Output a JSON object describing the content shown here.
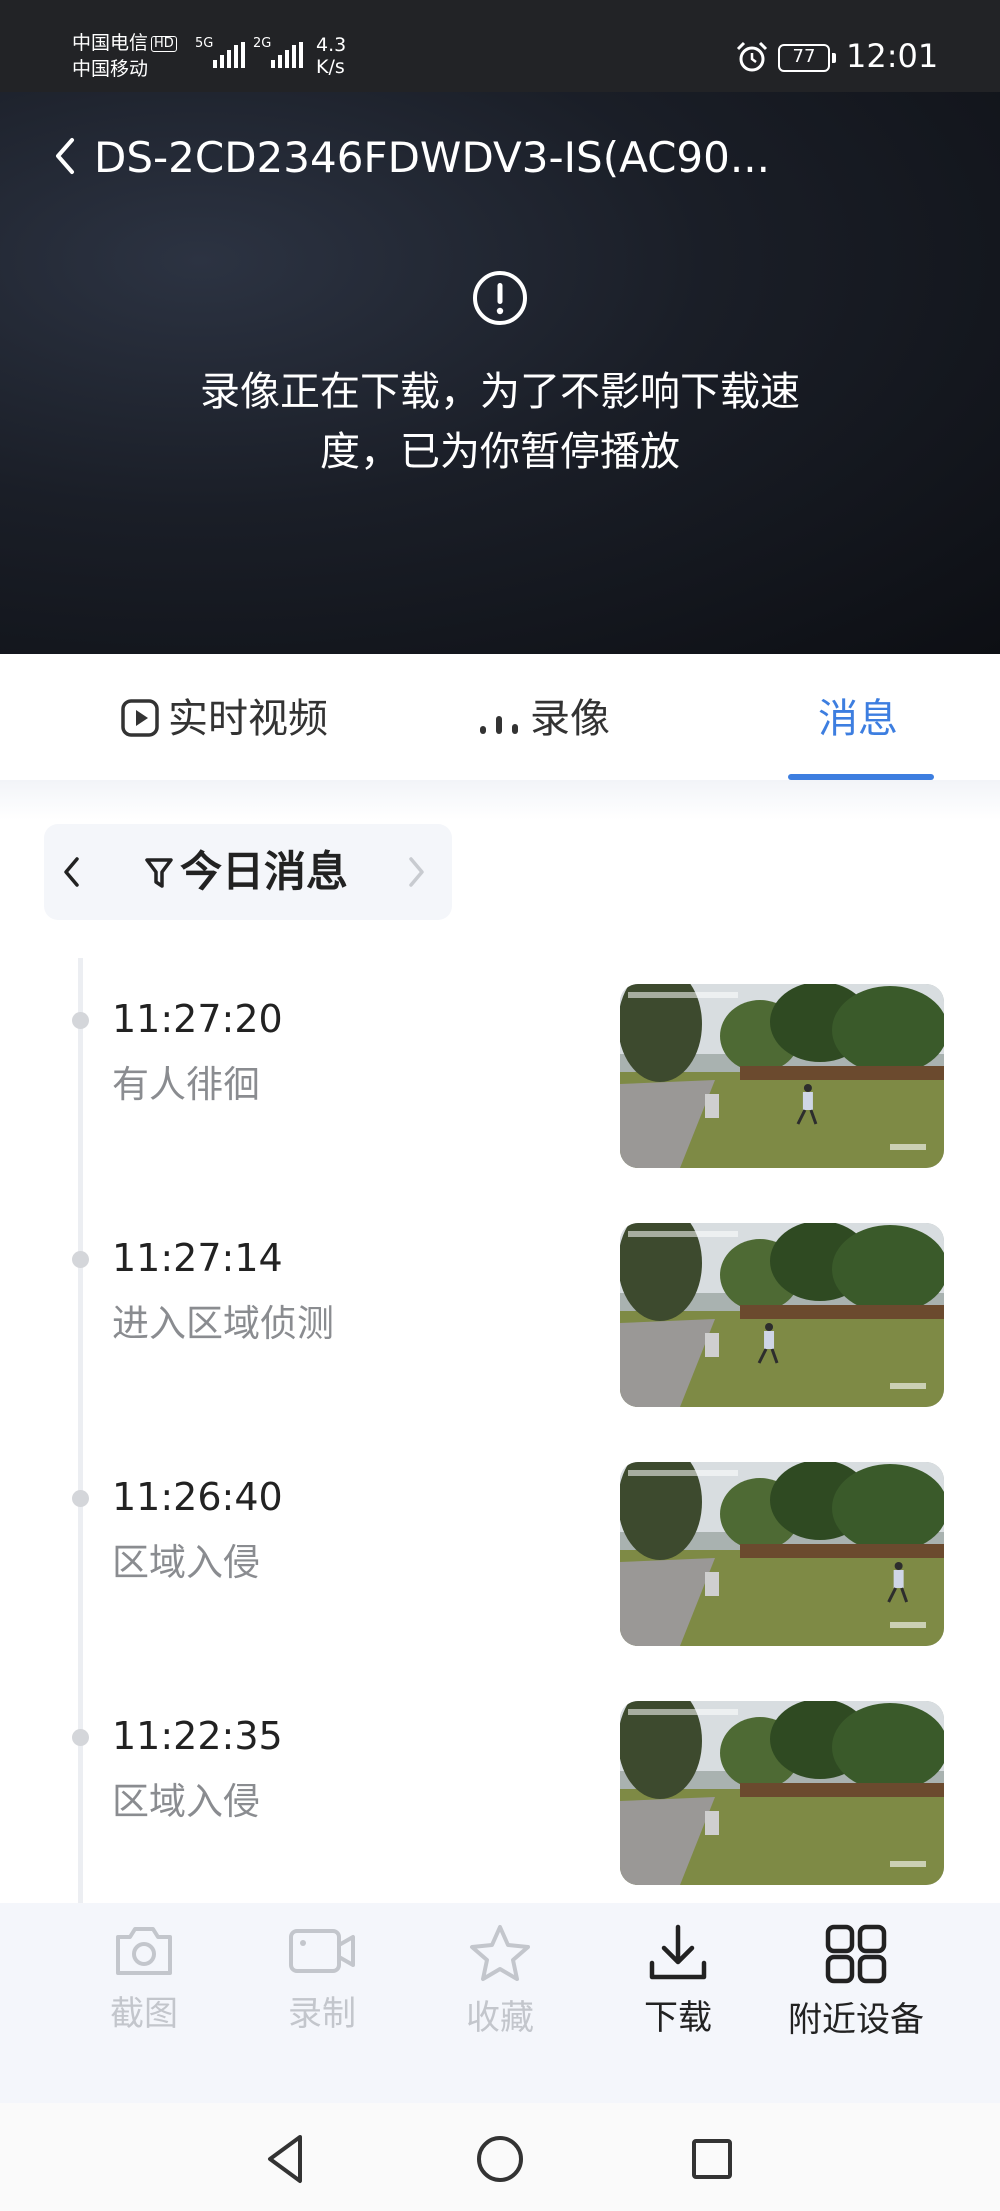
{
  "status_bar": {
    "carrier1": "中国电信",
    "hd_badge": "HD",
    "carrier2": "中国移动",
    "sig1_gen": "5G",
    "sig2_gen": "2G",
    "speed_value": "4.3",
    "speed_unit": "K/s",
    "battery": "77",
    "time": "12:01"
  },
  "video": {
    "title": "DS-2CD2346FDWDV3-IS(AC90...",
    "notice_line1": "录像正在下载，为了不影响下载速",
    "notice_line2": "度，已为你暂停播放"
  },
  "tabs": [
    {
      "label": "实时视频",
      "active": false,
      "icon": "play-square-icon"
    },
    {
      "label": "录像",
      "active": false,
      "icon": "bars-loading-icon"
    },
    {
      "label": "消息",
      "active": true
    }
  ],
  "filter": {
    "label": "今日消息"
  },
  "messages": [
    {
      "time": "11:27:20",
      "event": "有人徘徊",
      "person": 0.58
    },
    {
      "time": "11:27:14",
      "event": "进入区域侦测",
      "person": 0.46
    },
    {
      "time": "11:26:40",
      "event": "区域入侵",
      "person": 0.86
    },
    {
      "time": "11:22:35",
      "event": "区域入侵",
      "person": null
    }
  ],
  "toolbar": [
    {
      "label": "截图",
      "icon": "camera-icon",
      "enabled": false
    },
    {
      "label": "录制",
      "icon": "video-camera-icon",
      "enabled": false
    },
    {
      "label": "收藏",
      "icon": "star-icon",
      "enabled": false
    },
    {
      "label": "下载",
      "icon": "download-icon",
      "enabled": true
    },
    {
      "label": "附近设备",
      "icon": "grid-icon",
      "enabled": true
    }
  ],
  "colors": {
    "accent": "#3d7ee0",
    "status_bar_bg": "#222326",
    "toolbar_bg": "#f4f6fb"
  }
}
